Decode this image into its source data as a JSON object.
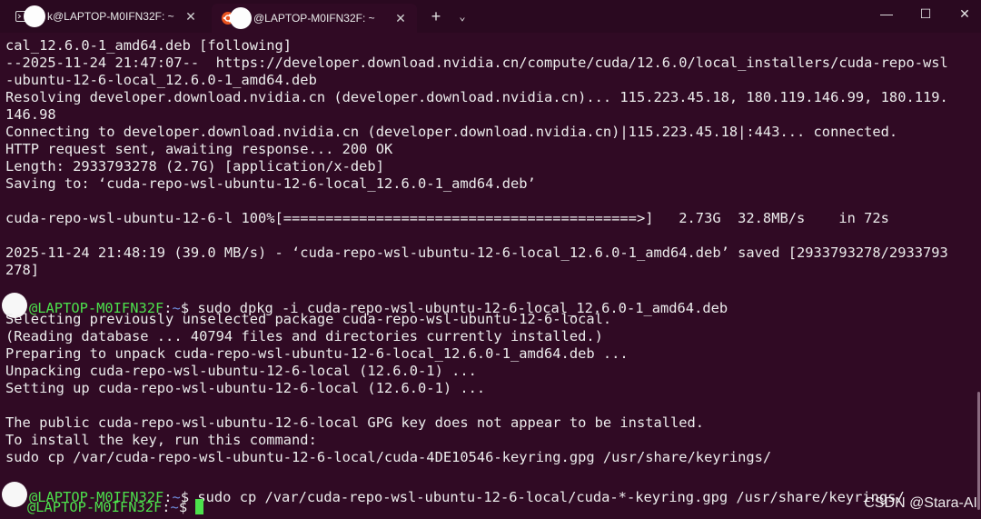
{
  "tabs": [
    {
      "title": "k@LAPTOP-M0IFN32F: ~",
      "icon": "terminal-icon",
      "close": "✕"
    },
    {
      "title": "@LAPTOP-M0IFN32F: ~",
      "icon": "ubuntu-icon",
      "close": "✕"
    }
  ],
  "new_tab": "+",
  "dropdown": "⌄",
  "window_controls": {
    "minimize": "—",
    "maximize": "☐",
    "close": "✕"
  },
  "terminal": {
    "lines": [
      "cal_12.6.0-1_amd64.deb [following]",
      "--2025-11-24 21:47:07--  https://developer.download.nvidia.cn/compute/cuda/12.6.0/local_installers/cuda-repo-wsl",
      "-ubuntu-12-6-local_12.6.0-1_amd64.deb",
      "Resolving developer.download.nvidia.cn (developer.download.nvidia.cn)... 115.223.45.18, 180.119.146.99, 180.119.",
      "146.98",
      "Connecting to developer.download.nvidia.cn (developer.download.nvidia.cn)|115.223.45.18|:443... connected.",
      "HTTP request sent, awaiting response... 200 OK",
      "Length: 2933793278 (2.7G) [application/x-deb]",
      "Saving to: ‘cuda-repo-wsl-ubuntu-12-6-local_12.6.0-1_amd64.deb’",
      "",
      "cuda-repo-wsl-ubuntu-12-6-l 100%[==========================================>]   2.73G  32.8MB/s    in 72s",
      "",
      "2025-11-24 21:48:19 (39.0 MB/s) - ‘cuda-repo-wsl-ubuntu-12-6-local_12.6.0-1_amd64.deb’ saved [2933793278/2933793",
      "278]",
      "",
      "",
      "Selecting previously unselected package cuda-repo-wsl-ubuntu-12-6-local.",
      "(Reading database ... 40794 files and directories currently installed.)",
      "Preparing to unpack cuda-repo-wsl-ubuntu-12-6-local_12.6.0-1_amd64.deb ...",
      "Unpacking cuda-repo-wsl-ubuntu-12-6-local (12.6.0-1) ...",
      "Setting up cuda-repo-wsl-ubuntu-12-6-local (12.6.0-1) ...",
      "",
      "The public cuda-repo-wsl-ubuntu-12-6-local GPG key does not appear to be installed.",
      "To install the key, run this command:",
      "sudo cp /var/cuda-repo-wsl-ubuntu-12-6-local/cuda-4DE10546-keyring.gpg /usr/share/keyrings/"
    ],
    "prompt": {
      "host": "@LAPTOP-M0IFN32F",
      "sep": ":",
      "path": "~",
      "dollar": "$"
    },
    "commands": [
      " sudo dpkg -i cuda-repo-wsl-ubuntu-12-6-local_12.6.0-1_amd64.deb",
      " sudo cp /var/cuda-repo-wsl-ubuntu-12-6-local/cuda-*-keyring.gpg /usr/share/keyrings/",
      " "
    ]
  },
  "watermark": "CSDN @Stara-AI",
  "colors": {
    "background": "#300a24",
    "host": "#4ce14c",
    "path": "#6f8fe0",
    "text": "#ececec"
  }
}
